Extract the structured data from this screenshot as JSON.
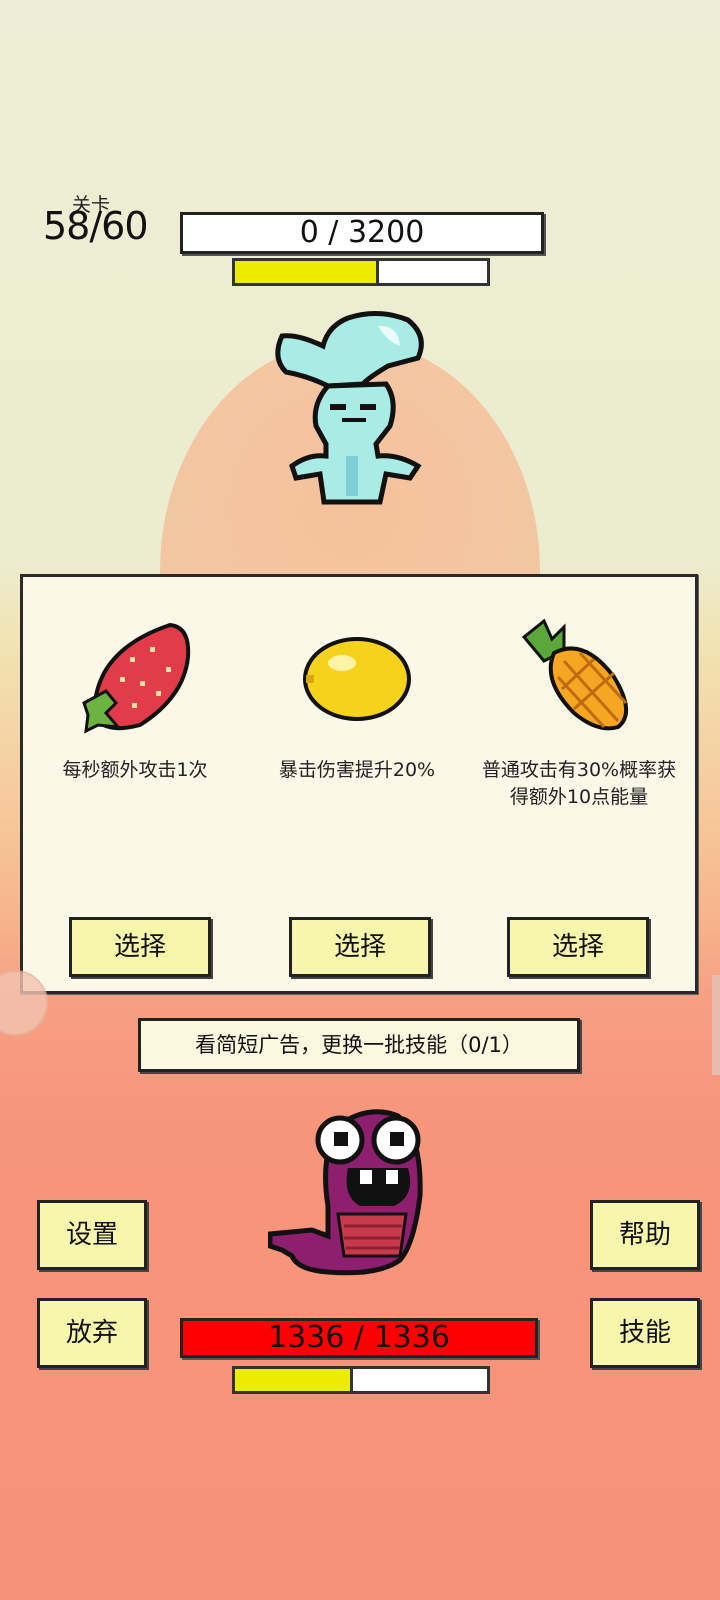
{
  "stage": {
    "label": "关卡",
    "count": "58/60"
  },
  "enemy": {
    "hp_text": "0 / 3200",
    "energy_fraction": 0.57
  },
  "choices": [
    {
      "icon": "strawberry-icon",
      "desc": "每秒额外攻击1次",
      "button": "选择"
    },
    {
      "icon": "lemon-icon",
      "desc": "暴击伤害提升20%",
      "button": "选择"
    },
    {
      "icon": "pineapple-icon",
      "desc": "普通攻击有30%概率获得额外10点能量",
      "button": "选择"
    }
  ],
  "ad_refresh": "看简短广告，更换一批技能（0/1）",
  "buttons": {
    "settings": "设置",
    "help": "帮助",
    "give_up": "放弃",
    "skills": "技能"
  },
  "player": {
    "hp_text": "1336 / 1336",
    "energy_fraction": 0.47
  },
  "colors": {
    "player_hp": "#ff0000",
    "energy": "#ecec00",
    "button_bg": "#f7f6ad"
  }
}
